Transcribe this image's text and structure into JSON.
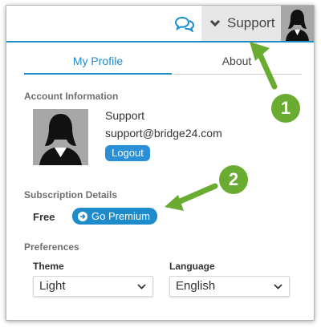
{
  "topbar": {
    "chat_icon": "chat-bubbles-icon",
    "support_label": "Support",
    "accent_color": "#1e8bcb"
  },
  "tabs": [
    {
      "label": "My Profile",
      "active": true
    },
    {
      "label": "About",
      "active": false
    }
  ],
  "account": {
    "section_title": "Account Information",
    "name": "Support",
    "email": "support@bridge24.com",
    "logout_label": "Logout"
  },
  "subscription": {
    "section_title": "Subscription Details",
    "plan": "Free",
    "premium_label": "Go Premium"
  },
  "preferences": {
    "section_title": "Preferences",
    "theme_label": "Theme",
    "theme_value": "Light",
    "language_label": "Language",
    "language_value": "English"
  },
  "annotations": {
    "badge_1": "1",
    "badge_2": "2",
    "color": "#6aab32"
  }
}
